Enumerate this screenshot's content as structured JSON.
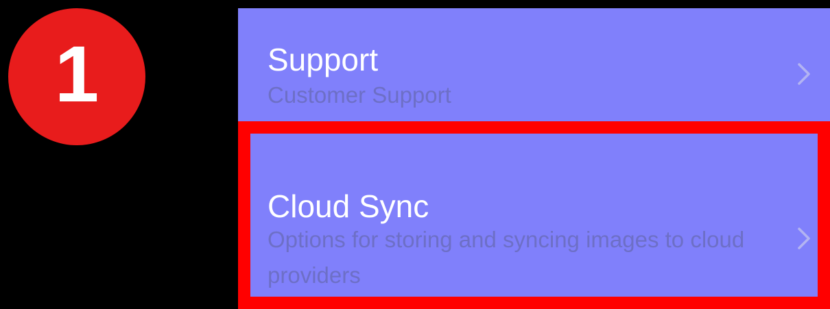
{
  "step_badge": {
    "number": "1",
    "color": "#e81c1c"
  },
  "settings": {
    "background": "#8080fb",
    "items": [
      {
        "title": "Support",
        "subtitle": "Customer Support",
        "icon": "chevron-right-icon"
      },
      {
        "title": "Cloud Sync",
        "subtitle": "Options for storing and syncing images to cloud providers",
        "icon": "chevron-right-icon",
        "highlighted": true
      }
    ]
  },
  "highlight_color": "#ff0000"
}
